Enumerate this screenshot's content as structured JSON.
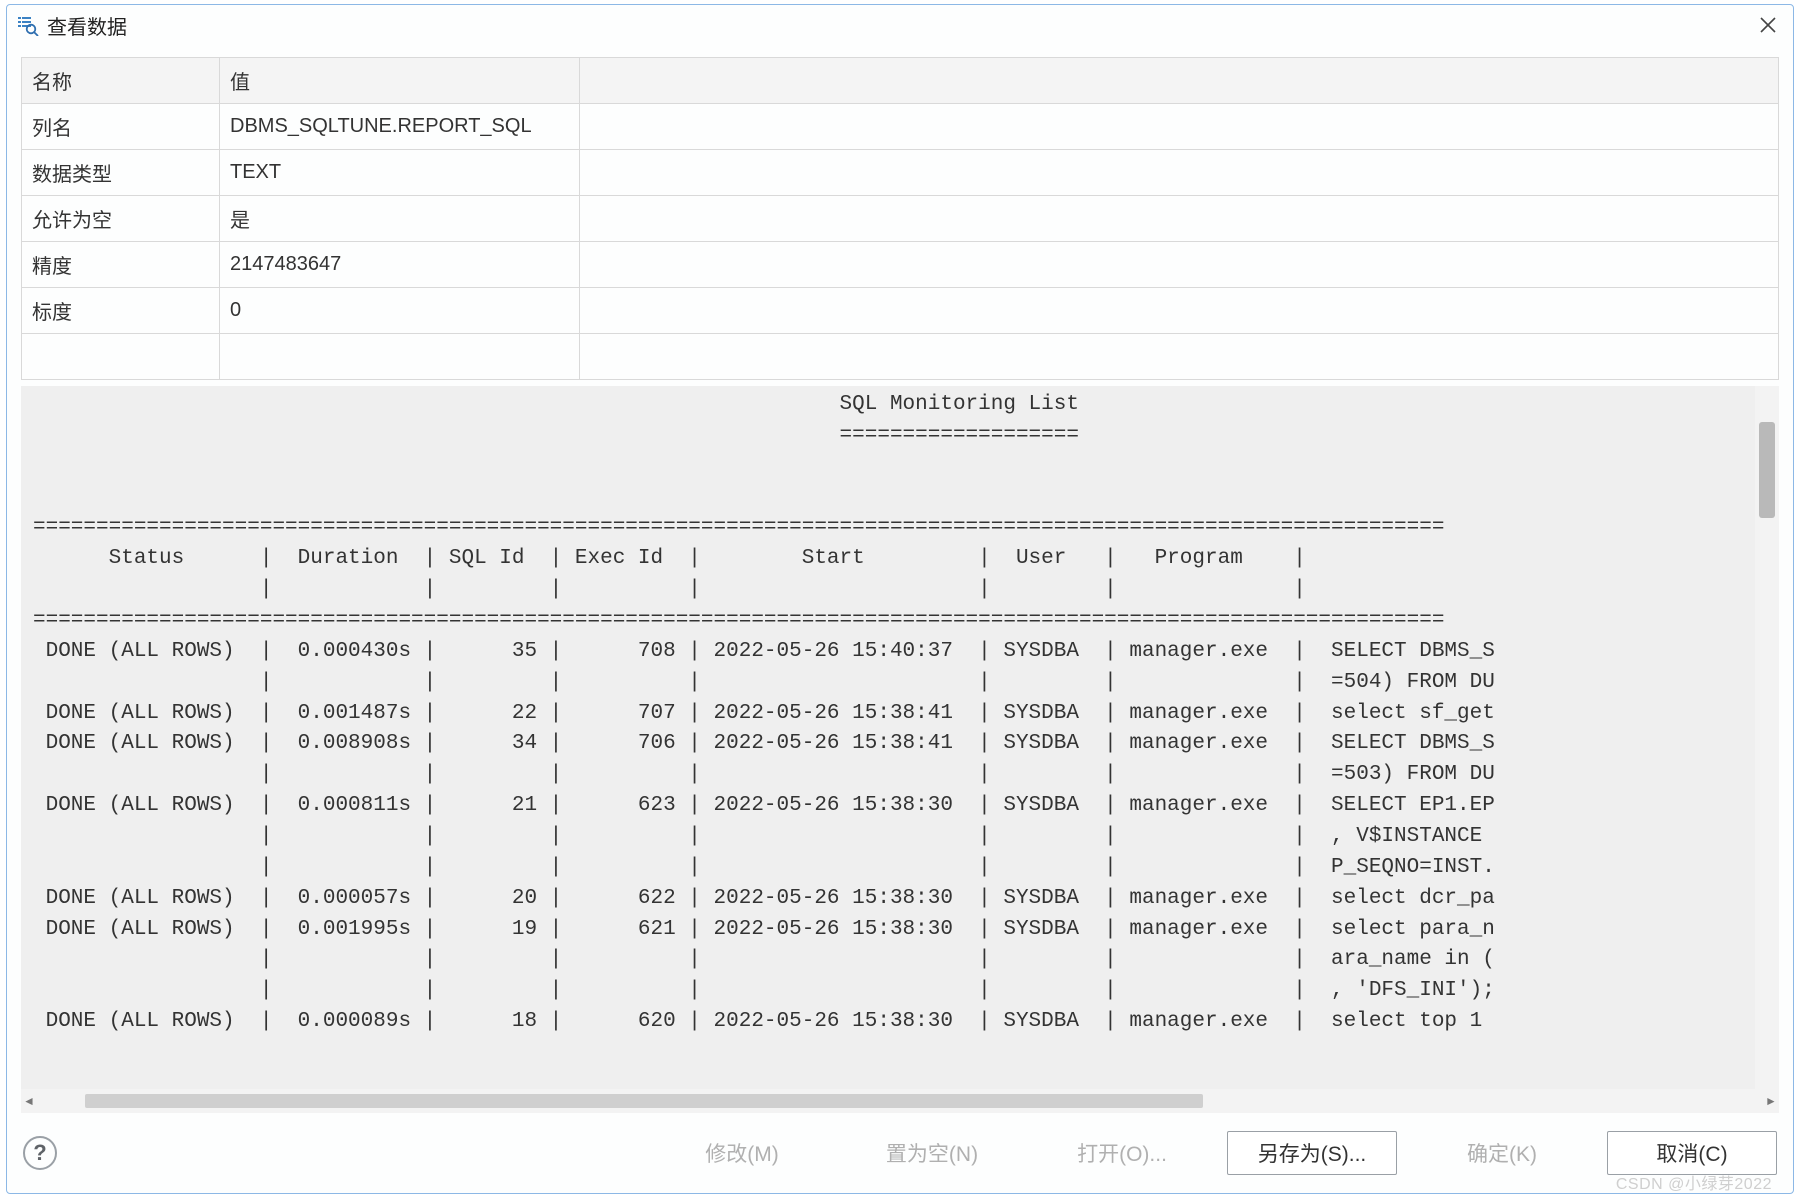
{
  "dialog": {
    "title": "查看数据"
  },
  "prop_table": {
    "headers": {
      "name": "名称",
      "value": "值"
    },
    "rows": [
      {
        "name": "列名",
        "value": "DBMS_SQLTUNE.REPORT_SQL"
      },
      {
        "name": "数据类型",
        "value": "TEXT"
      },
      {
        "name": "允许为空",
        "value": "是"
      },
      {
        "name": "精度",
        "value": "2147483647"
      },
      {
        "name": "标度",
        "value": "0"
      }
    ]
  },
  "content": {
    "title": "SQL Monitoring List",
    "underline": "===================",
    "headers": [
      "Status",
      "Duration",
      "SQL Id",
      "Exec Id",
      "Start",
      "User",
      "Program"
    ],
    "rows": [
      {
        "status": "DONE (ALL ROWS)",
        "duration": "0.000430s",
        "sql_id": "35",
        "exec_id": "708",
        "start": "2022-05-26 15:40:37",
        "user": "SYSDBA",
        "program": "manager.exe",
        "extra": [
          "SELECT DBMS_S",
          "=504) FROM DU"
        ]
      },
      {
        "status": "DONE (ALL ROWS)",
        "duration": "0.001487s",
        "sql_id": "22",
        "exec_id": "707",
        "start": "2022-05-26 15:38:41",
        "user": "SYSDBA",
        "program": "manager.exe",
        "extra": [
          "select sf_get"
        ]
      },
      {
        "status": "DONE (ALL ROWS)",
        "duration": "0.008908s",
        "sql_id": "34",
        "exec_id": "706",
        "start": "2022-05-26 15:38:41",
        "user": "SYSDBA",
        "program": "manager.exe",
        "extra": [
          "SELECT DBMS_S",
          "=503) FROM DU"
        ]
      },
      {
        "status": "DONE (ALL ROWS)",
        "duration": "0.000811s",
        "sql_id": "21",
        "exec_id": "623",
        "start": "2022-05-26 15:38:30",
        "user": "SYSDBA",
        "program": "manager.exe",
        "extra": [
          "SELECT EP1.EP",
          ", V$INSTANCE ",
          "P_SEQNO=INST."
        ]
      },
      {
        "status": "DONE (ALL ROWS)",
        "duration": "0.000057s",
        "sql_id": "20",
        "exec_id": "622",
        "start": "2022-05-26 15:38:30",
        "user": "SYSDBA",
        "program": "manager.exe",
        "extra": [
          "select dcr_pa"
        ]
      },
      {
        "status": "DONE (ALL ROWS)",
        "duration": "0.001995s",
        "sql_id": "19",
        "exec_id": "621",
        "start": "2022-05-26 15:38:30",
        "user": "SYSDBA",
        "program": "manager.exe",
        "extra": [
          "select para_n",
          "ara_name in (",
          ", 'DFS_INI');"
        ]
      },
      {
        "status": "DONE (ALL ROWS)",
        "duration": "0.000089s",
        "sql_id": "18",
        "exec_id": "620",
        "start": "2022-05-26 15:38:30",
        "user": "SYSDBA",
        "program": "manager.exe",
        "extra": [
          "select top 1 "
        ]
      }
    ]
  },
  "buttons": {
    "modify": "修改(M)",
    "set_null": "置为空(N)",
    "open": "打开(O)...",
    "save_as": "另存为(S)...",
    "ok": "确定(K)",
    "cancel": "取消(C)"
  },
  "watermark": "CSDN @小绿芽2022"
}
